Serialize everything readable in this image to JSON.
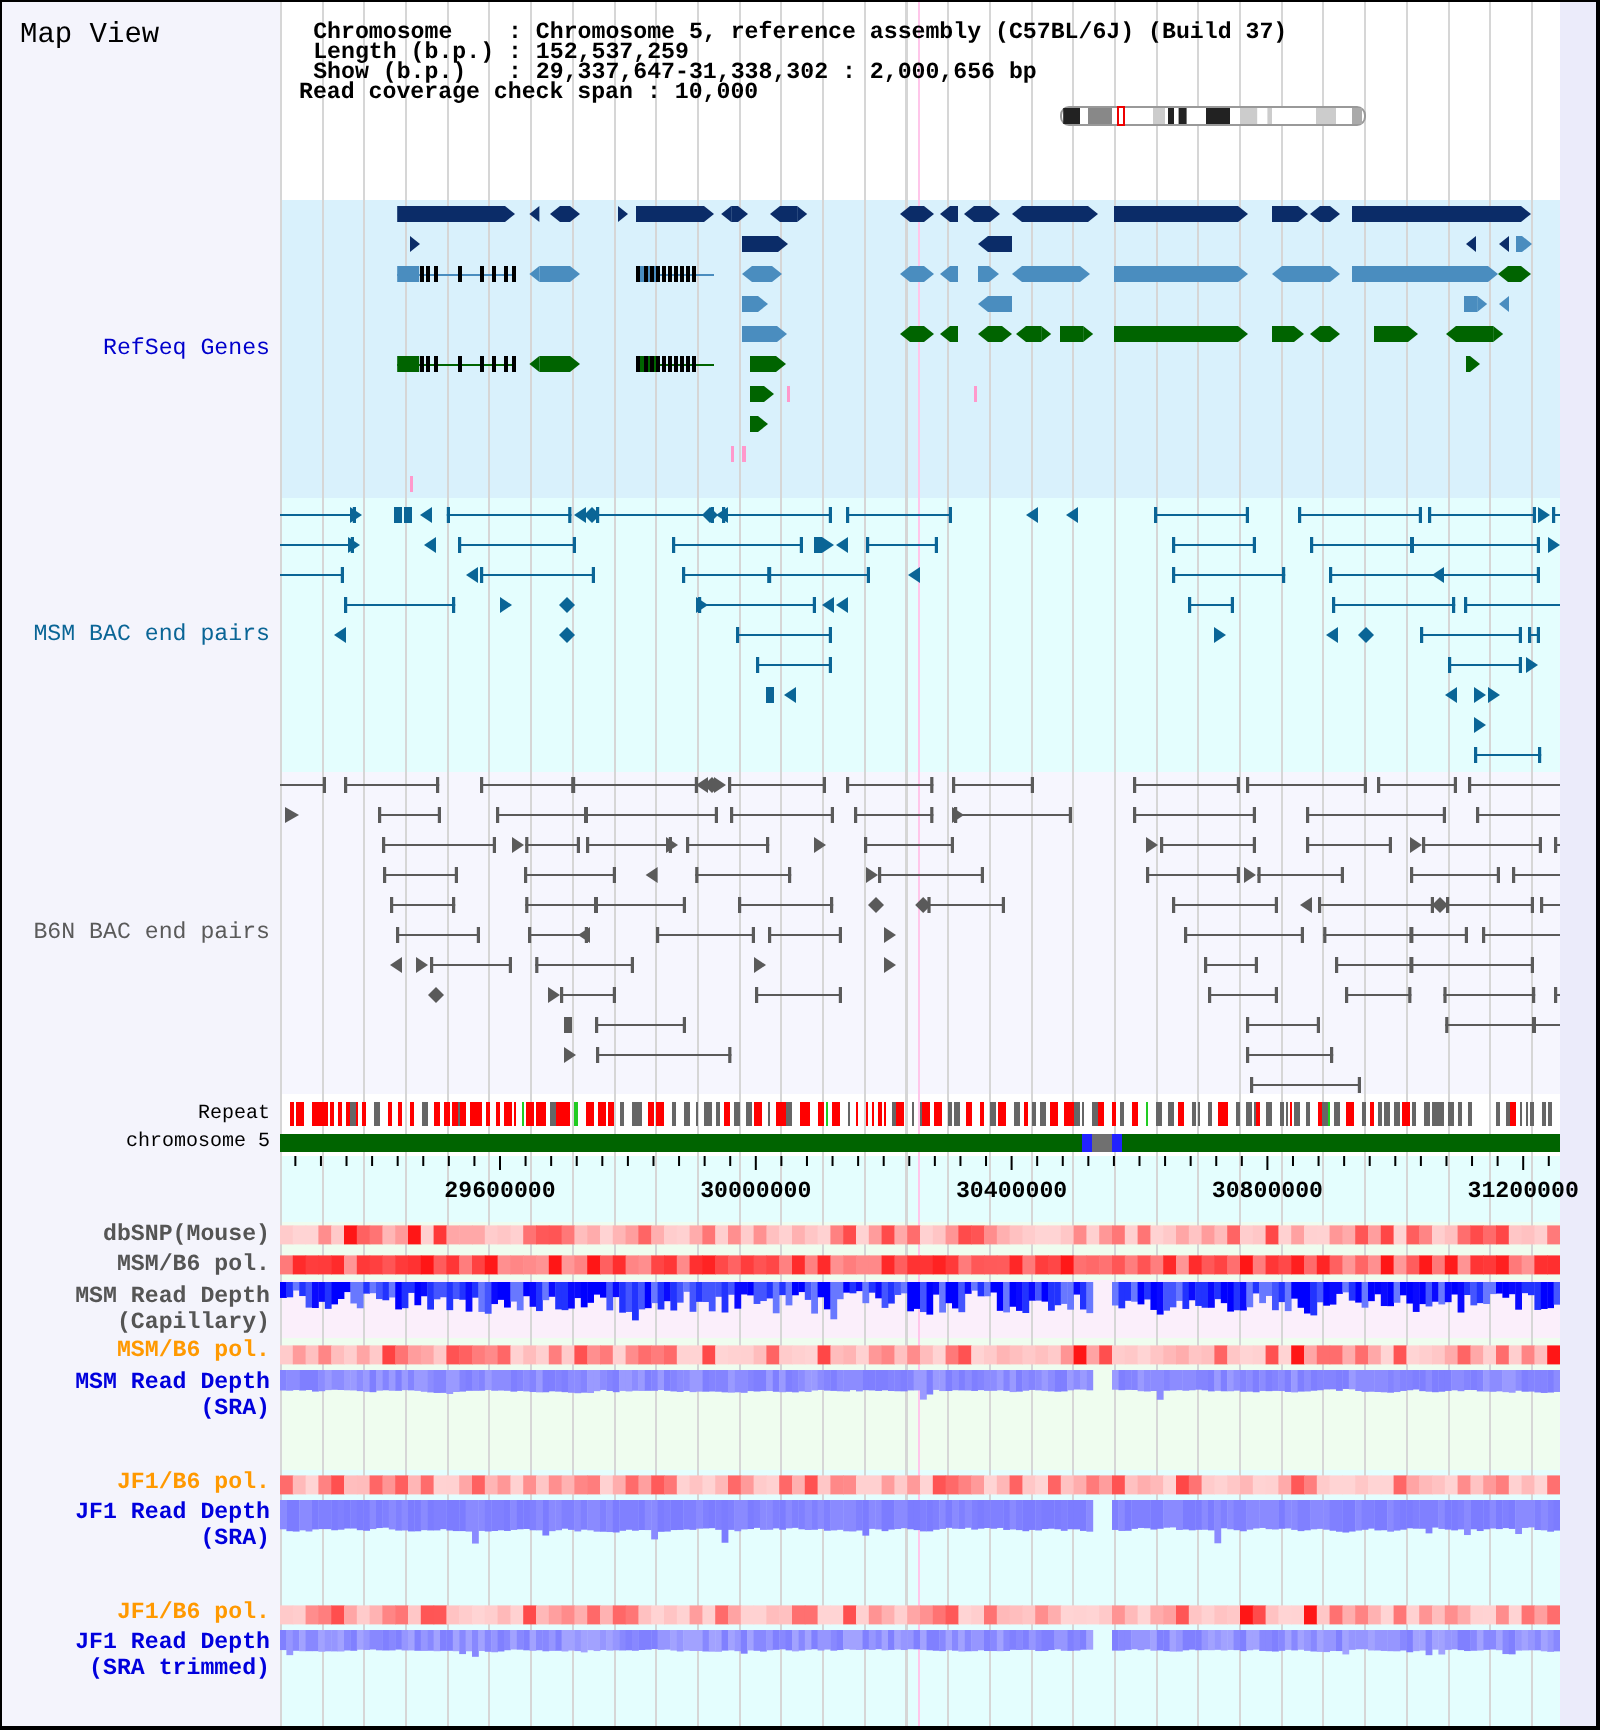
{
  "title": "Map View",
  "info": [
    {
      "label": "Chromosome",
      "sep": ":",
      "value": "Chromosome 5, reference assembly (C57BL/6J) (Build 37)"
    },
    {
      "label": "Length (b.p.)",
      "sep": ":",
      "value": "152,537,259"
    },
    {
      "label": "Show (b.p.)",
      "sep": ":",
      "value": "29,337,647-31,338,302 : 2,000,656 bp"
    }
  ],
  "coverage": {
    "label": "Read coverage check span",
    "sep": ":",
    "value": "10,000"
  },
  "tracks": [
    {
      "kind": "genes",
      "label": "RefSeq Genes",
      "color": "#0000cc"
    },
    {
      "kind": "bac_pairs",
      "label": "MSM BAC end pairs",
      "color": "#0a6596"
    },
    {
      "kind": "bac_pairs",
      "label": "B6N BAC end pairs",
      "color": "#5a5a5a"
    },
    {
      "kind": "repeat",
      "label": "Repeat",
      "color": "#000000"
    },
    {
      "kind": "chromosome",
      "label": "chromosome 5",
      "color": "#000000"
    }
  ],
  "axis_labels": [
    "29600000",
    "30000000",
    "30400000",
    "30800000",
    "31200000"
  ],
  "lower_tracks": [
    {
      "kind": "heatmap",
      "label": "dbSNP(Mouse)",
      "color": "#555555"
    },
    {
      "kind": "heatmap",
      "label": "MSM/B6 pol.",
      "color": "#555555"
    },
    {
      "kind": "depth",
      "label": "MSM Read Depth (Capillary)",
      "color": "#555555"
    },
    {
      "kind": "heatmap",
      "label": "MSM/B6 pol.",
      "color": "#ff9900"
    },
    {
      "kind": "depth",
      "label": "MSM Read Depth (SRA)",
      "color": "#0000dd"
    },
    {
      "kind": "heatmap",
      "label": "JF1/B6 pol.",
      "color": "#ff9900"
    },
    {
      "kind": "depth",
      "label": "JF1 Read Depth (SRA)",
      "color": "#0000dd"
    },
    {
      "kind": "heatmap",
      "label": "JF1/B6 pol.",
      "color": "#ff9900"
    },
    {
      "kind": "depth",
      "label": "JF1 Read Depth (SRA trimmed)",
      "color": "#0000dd"
    }
  ]
}
